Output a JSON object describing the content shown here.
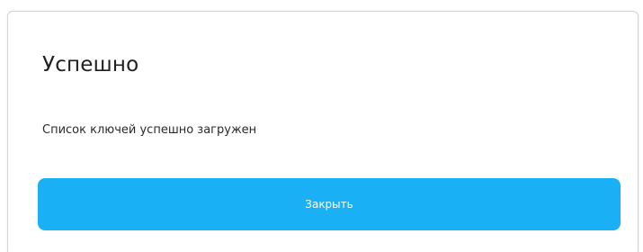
{
  "dialog": {
    "title": "Успешно",
    "message": "Список ключей успешно загружен",
    "close_label": "Закрыть"
  },
  "colors": {
    "accent": "#1ab0f5",
    "border": "#d4d4d4",
    "text": "#1f1f1f",
    "background": "#ffffff"
  }
}
